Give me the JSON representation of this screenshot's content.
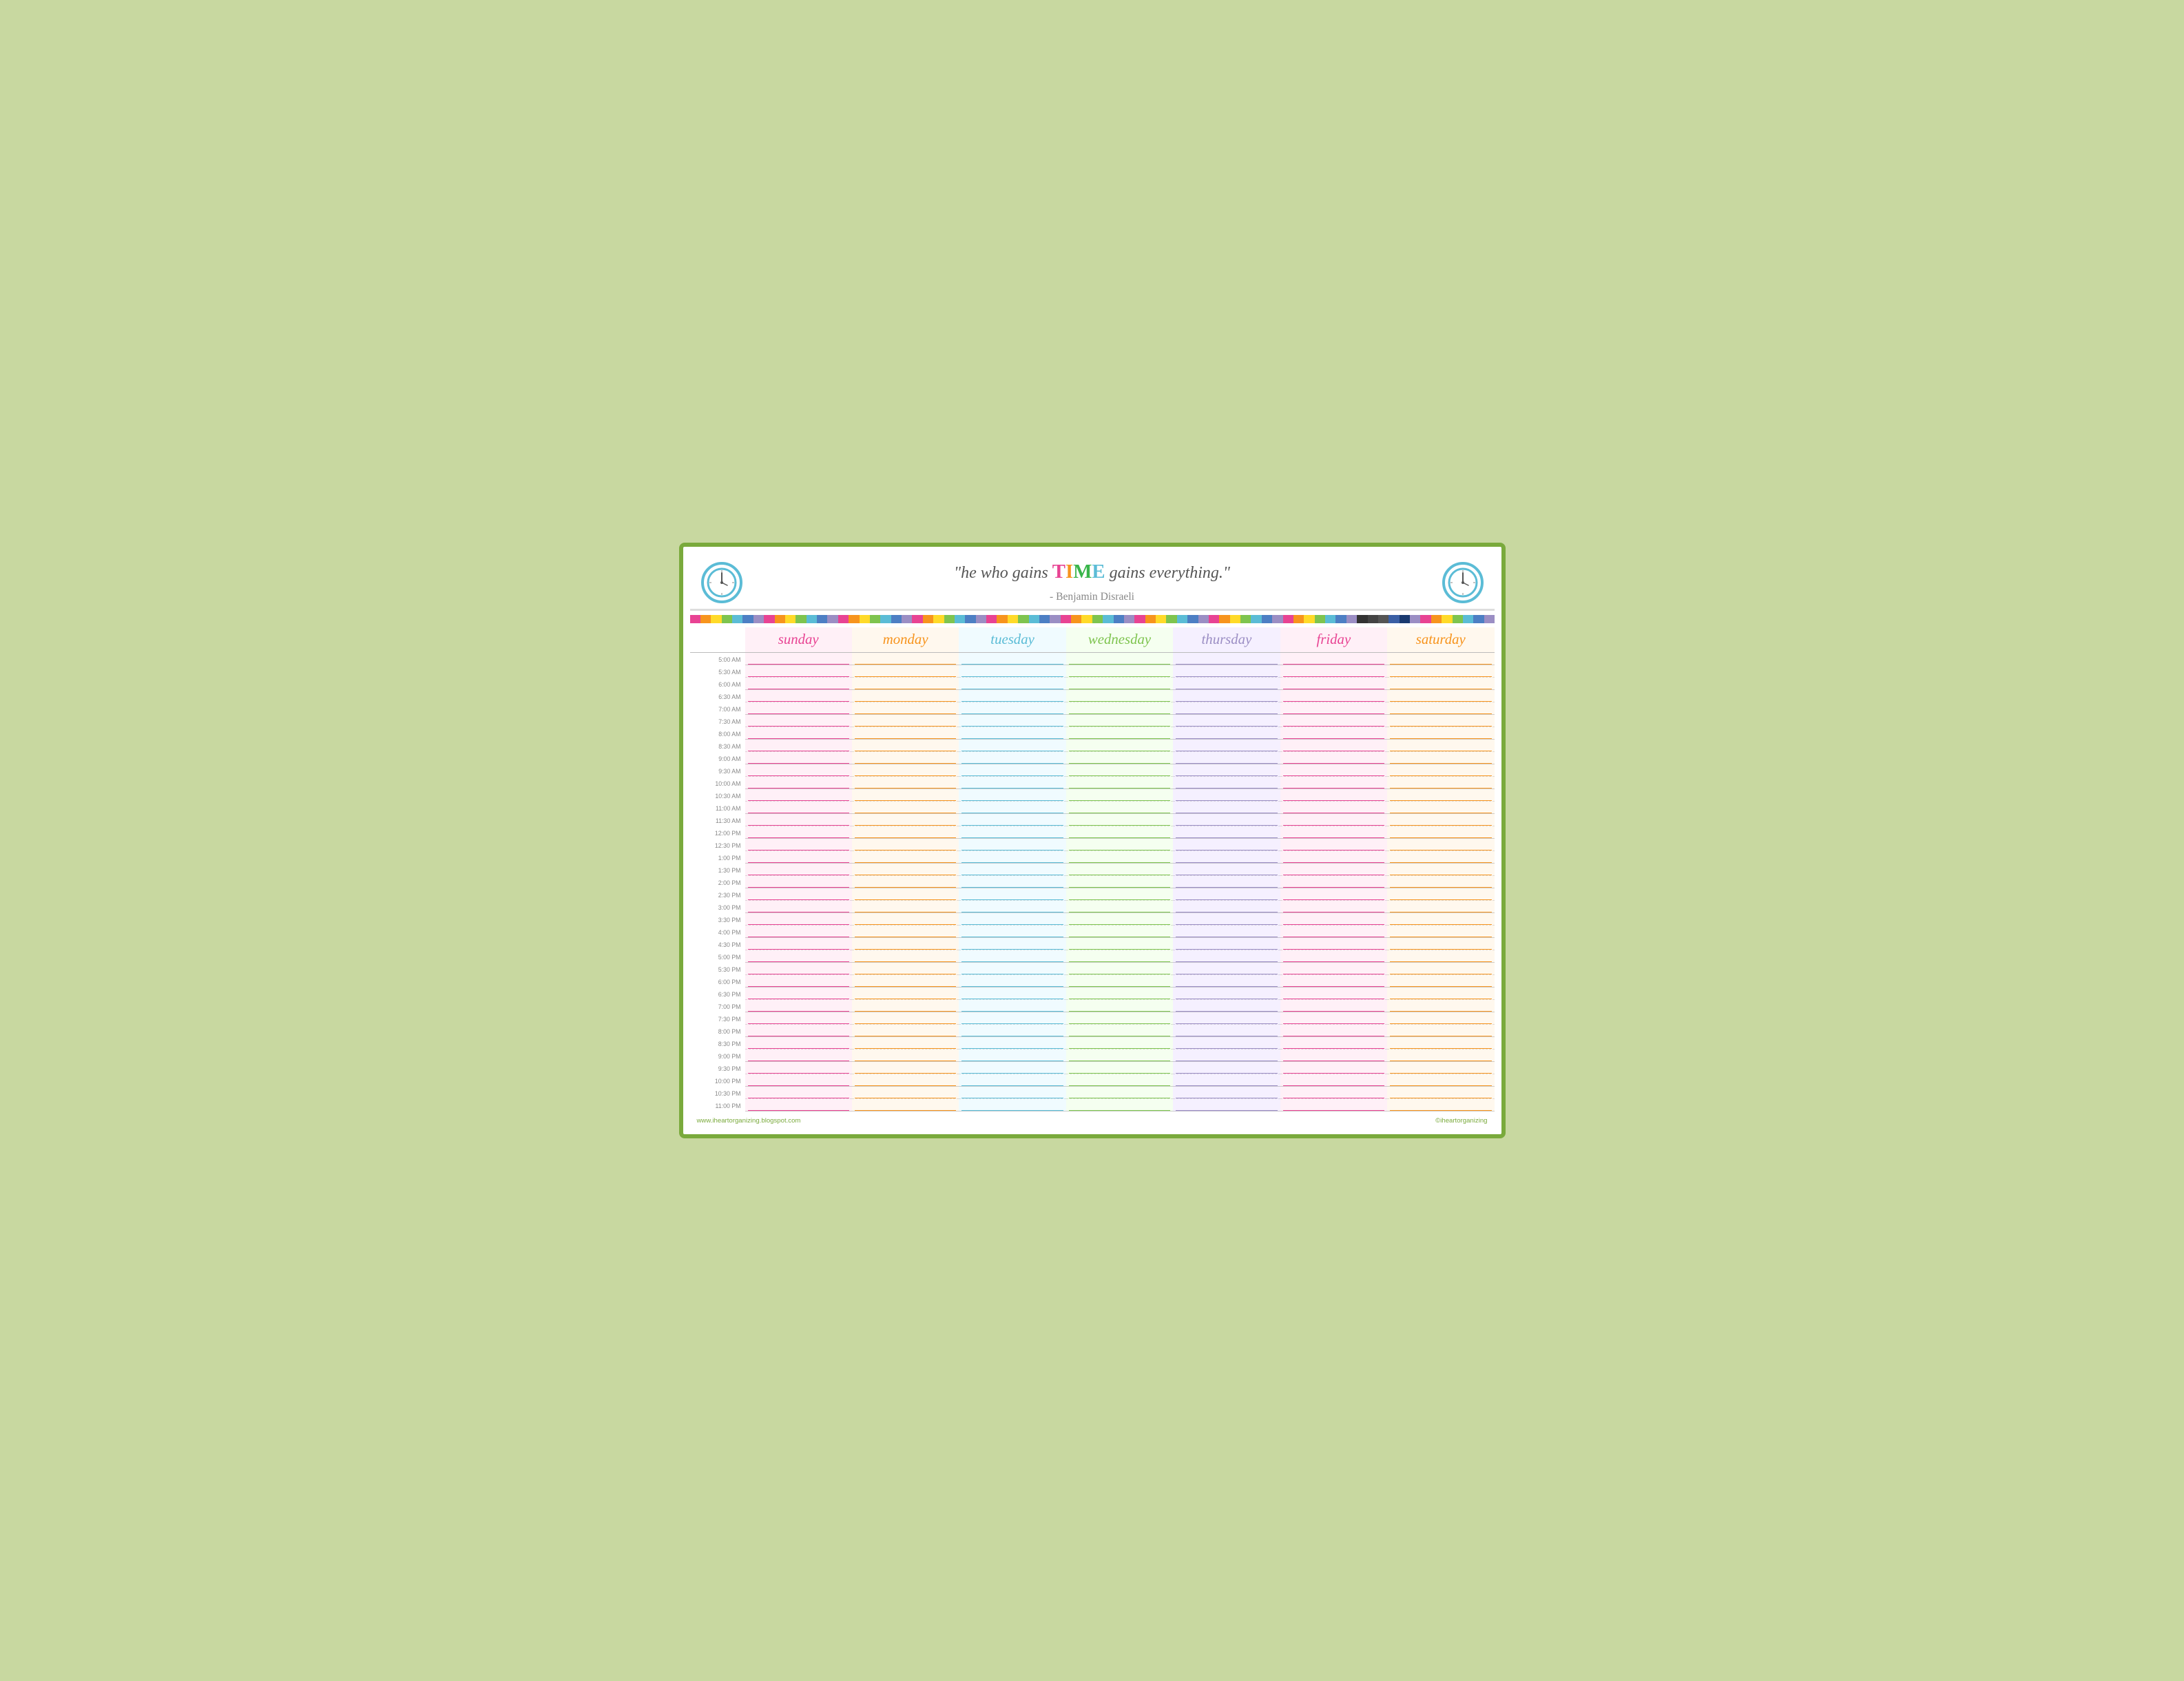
{
  "header": {
    "quote_start": "\"he who gains ",
    "quote_time_word": "TIME",
    "quote_end": " gains everything.\"",
    "author": "- Benjamin Disraeli",
    "clock_left_label": "clock-left",
    "clock_right_label": "clock-right"
  },
  "days": {
    "labels": [
      "sunday",
      "monday",
      "tuesday",
      "wednesday",
      "thursday",
      "friday",
      "saturday"
    ],
    "classes": [
      "day-sun",
      "day-mon",
      "day-tue",
      "day-wed",
      "day-thu",
      "day-fri",
      "day-sat"
    ],
    "col_classes": [
      "col-sun",
      "col-mon",
      "col-tue",
      "col-wed",
      "col-thu",
      "col-fri",
      "col-sat"
    ],
    "line_classes": [
      "line-sun",
      "line-mon",
      "line-tue",
      "line-wed",
      "line-thu",
      "line-fri",
      "line-sat"
    ]
  },
  "time_slots": [
    "5:00 AM",
    "5:30 AM",
    "6:00 AM",
    "6:30 AM",
    "7:00 AM",
    "7:30 AM",
    "8:00 AM",
    "8:30 AM",
    "9:00 AM",
    "9:30 AM",
    "10:00 AM",
    "10:30 AM",
    "11:00 AM",
    "11:30 AM",
    "12:00 PM",
    "12:30 PM",
    "1:00 PM",
    "1:30 PM",
    "2:00 PM",
    "2:30 PM",
    "3:00 PM",
    "3:30 PM",
    "4:00 PM",
    "4:30 PM",
    "5:00 PM",
    "5:30 PM",
    "6:00 PM",
    "6:30 PM",
    "7:00 PM",
    "7:30 PM",
    "8:00 PM",
    "8:30 PM",
    "9:00 PM",
    "9:30 PM",
    "10:00 PM",
    "10:30 PM",
    "11:00 PM"
  ],
  "rainbow_colors": [
    "#e84393",
    "#f7941d",
    "#ffda29",
    "#7ec44f",
    "#5bbcd6",
    "#4d7fc4",
    "#9b8ec4",
    "#e84393",
    "#f7941d",
    "#ffda29",
    "#7ec44f",
    "#5bbcd6",
    "#4d7fc4",
    "#9b8ec4",
    "#e84393",
    "#f7941d",
    "#ffda29",
    "#7ec44f",
    "#5bbcd6",
    "#4d7fc4",
    "#9b8ec4",
    "#e84393",
    "#f7941d",
    "#ffda29",
    "#7ec44f",
    "#5bbcd6",
    "#4d7fc4",
    "#9b8ec4",
    "#e84393",
    "#f7941d",
    "#ffda29",
    "#7ec44f",
    "#5bbcd6",
    "#4d7fc4",
    "#9b8ec4",
    "#e84393",
    "#f7941d",
    "#ffda29",
    "#7ec44f",
    "#5bbcd6",
    "#4d7fc4",
    "#9b8ec4",
    "#e84393",
    "#f7941d",
    "#ffda29",
    "#7ec44f",
    "#5bbcd6",
    "#4d7fc4",
    "#9b8ec4",
    "#e84393",
    "#f7941d",
    "#ffda29",
    "#7ec44f",
    "#5bbcd6",
    "#4d7fc4",
    "#9b8ec4",
    "#e84393",
    "#f7941d",
    "#ffda29",
    "#7ec44f",
    "#5bbcd6",
    "#4d7fc4",
    "#9b8ec4",
    "#333333",
    "#444444",
    "#555555",
    "#3a5fa5",
    "#1a3a70",
    "#9b8ec4",
    "#e84393",
    "#f7941d",
    "#ffda29",
    "#7ec44f",
    "#5bbcd6",
    "#4d7fc4",
    "#9b8ec4"
  ],
  "footer": {
    "website": "www.iheartorganizing.blogspot.com",
    "copyright": "©iheartorganizing"
  }
}
